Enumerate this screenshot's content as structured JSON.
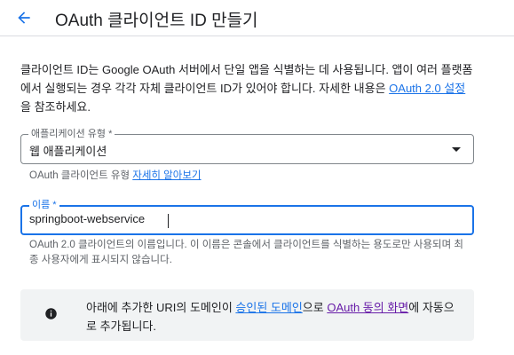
{
  "header": {
    "title": "OAuth 클라이언트 ID 만들기",
    "back_icon": "arrow-back-icon"
  },
  "intro": {
    "text_before": "클라이언트 ID는 Google OAuth 서버에서 단일 앱을 식별하는 데 사용됩니다. 앱이 여러 플랫폼에서 실행되는 경우 각각 자체 클라이언트 ID가 있어야 합니다. 자세한 내용은 ",
    "link": "OAuth 2.0 설정",
    "text_after": "을 참조하세요."
  },
  "app_type": {
    "label": "애플리케이션 유형 *",
    "value": "웹 애플리케이션",
    "hint_text": "OAuth 클라이언트 유형 ",
    "hint_link": "자세히 알아보기"
  },
  "name": {
    "label": "이름 *",
    "value": "springboot-webservice",
    "hint": "OAuth 2.0 클라이언트의 이름입니다. 이 이름은 콘솔에서 클라이언트를 식별하는 용도로만 사용되며 최종 사용자에게 표시되지 않습니다."
  },
  "notice": {
    "icon": "info-icon",
    "text_1": "아래에 추가한 URI의 도메인이 ",
    "link_1": "승인된 도메인",
    "text_2": "으로 ",
    "link_2": "OAuth 동의 화면",
    "text_3": "에 자동으로 추가됩니다."
  },
  "colors": {
    "link": "#1a73e8",
    "visited_link": "#681da8",
    "focus": "#1a73e8",
    "notice_bg": "#f1f3f4"
  }
}
